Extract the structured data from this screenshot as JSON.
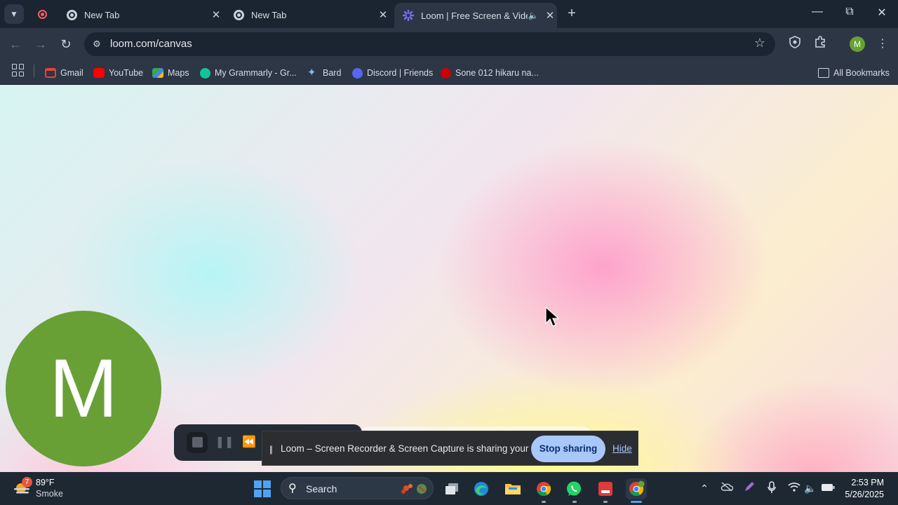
{
  "browser": {
    "tabs": [
      {
        "label": "New Tab",
        "active": false
      },
      {
        "label": "New Tab",
        "active": false
      },
      {
        "label": "Loom | Free Screen & Video Recording",
        "active": true
      }
    ],
    "address": "loom.com/canvas",
    "profile_initial": "M",
    "bookmarks": [
      {
        "label": "Gmail",
        "color": "#ea4335"
      },
      {
        "label": "YouTube",
        "color": "#ff0000"
      },
      {
        "label": "Maps",
        "color": "#34a853"
      },
      {
        "label": "My Grammarly - Gr...",
        "color": "#15c39a"
      },
      {
        "label": "Bard",
        "color": "#8ab4f8"
      },
      {
        "label": "Discord | Friends",
        "color": "#5865f2"
      },
      {
        "label": "Sone 012 hikaru na...",
        "color": "#cc0000"
      }
    ],
    "all_bookmarks": "All Bookmarks"
  },
  "loom": {
    "avatar_initial": "M",
    "avatar_color": "#68a035",
    "share_message": "Loom – Screen Recorder & Screen Capture is sharing your screen.",
    "stop_sharing": "Stop sharing",
    "hide": "Hide"
  },
  "taskbar": {
    "weather_badge": "7",
    "weather_temp": "89°F",
    "weather_desc": "Smoke",
    "search_label": "Search",
    "time": "2:53 PM",
    "date": "5/26/2025"
  },
  "colors": {
    "accent": "#a8c7fa",
    "windows_blue": "#4fa3f7"
  }
}
